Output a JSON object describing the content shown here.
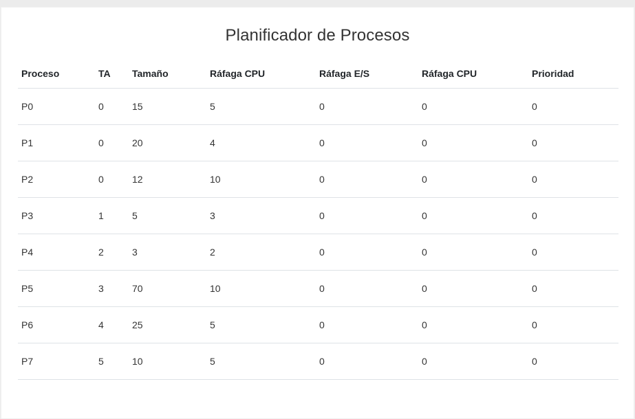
{
  "page": {
    "title": "Planificador de Procesos"
  },
  "table": {
    "headers": [
      "Proceso",
      "TA",
      "Tamaño",
      "Ráfaga CPU",
      "Ráfaga E/S",
      "Ráfaga CPU",
      "Prioridad"
    ],
    "rows": [
      [
        "P0",
        "0",
        "15",
        "5",
        "0",
        "0",
        "0"
      ],
      [
        "P1",
        "0",
        "20",
        "4",
        "0",
        "0",
        "0"
      ],
      [
        "P2",
        "0",
        "12",
        "10",
        "0",
        "0",
        "0"
      ],
      [
        "P3",
        "1",
        "5",
        "3",
        "0",
        "0",
        "0"
      ],
      [
        "P4",
        "2",
        "3",
        "2",
        "0",
        "0",
        "0"
      ],
      [
        "P5",
        "3",
        "70",
        "10",
        "0",
        "0",
        "0"
      ],
      [
        "P6",
        "4",
        "25",
        "5",
        "0",
        "0",
        "0"
      ],
      [
        "P7",
        "5",
        "10",
        "5",
        "0",
        "0",
        "0"
      ]
    ]
  }
}
